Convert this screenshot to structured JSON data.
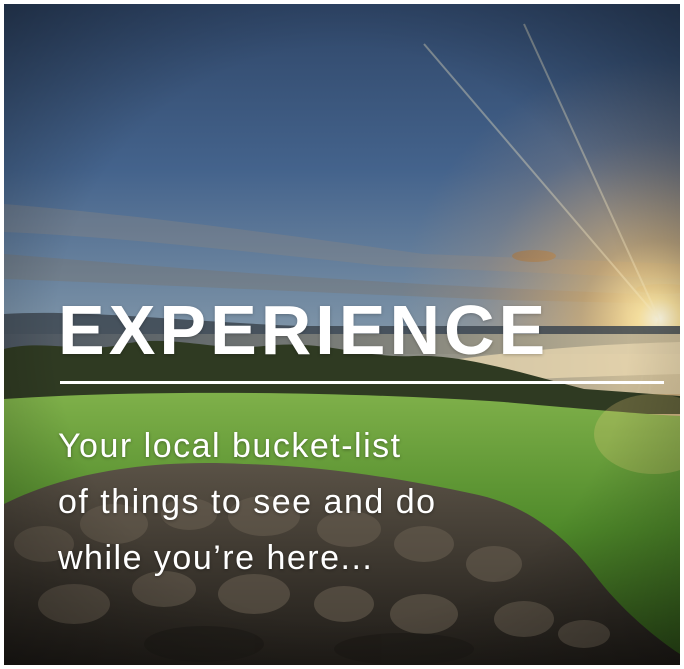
{
  "card": {
    "heading": "EXPERIENCE",
    "tagline_lines": [
      "Your local bucket-list",
      "of things to see and do",
      "while you’re here..."
    ]
  },
  "scene": {
    "description_colors": {
      "sky_top": "#3d5a7f",
      "sky_horizon": "#e9c28f",
      "sun": "#fff6d8",
      "grass": "#5e9a31",
      "stone": "#3b362f"
    }
  }
}
